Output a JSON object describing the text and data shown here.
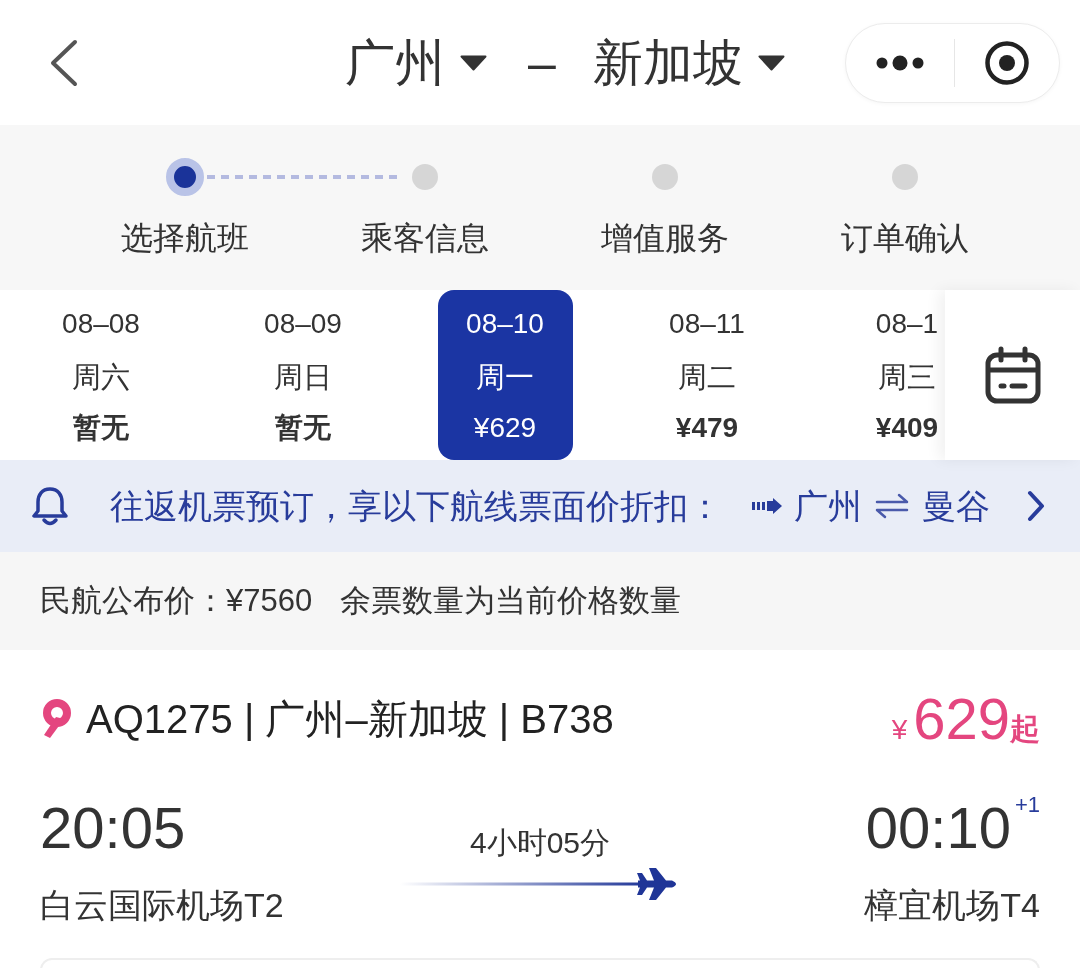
{
  "header": {
    "from_city": "广州",
    "separator": "–",
    "to_city": "新加坡"
  },
  "steps": [
    {
      "label": "选择航班",
      "selected": true
    },
    {
      "label": "乘客信息",
      "selected": false
    },
    {
      "label": "增值服务",
      "selected": false
    },
    {
      "label": "订单确认",
      "selected": false
    }
  ],
  "dates": [
    {
      "date": "08–08",
      "weekday": "周六",
      "price": "暂无",
      "selected": false
    },
    {
      "date": "08–09",
      "weekday": "周日",
      "price": "暂无",
      "selected": false
    },
    {
      "date": "08–10",
      "weekday": "周一",
      "price": "¥629",
      "selected": true
    },
    {
      "date": "08–11",
      "weekday": "周二",
      "price": "¥479",
      "selected": false
    },
    {
      "date": "08–1",
      "weekday": "周三",
      "price": "¥409",
      "selected": false
    }
  ],
  "promo_banner": {
    "text": "往返机票预订，享以下航线票面价折扣：",
    "from_city": "广州",
    "to_city": "曼谷"
  },
  "notice": {
    "official_price": "民航公布价：¥7560",
    "remark": "余票数量为当前价格数量"
  },
  "flight": {
    "title": "AQ1275 | 广州–新加坡 | B738",
    "price": {
      "currency": "¥",
      "amount": "629",
      "suffix": "起"
    },
    "departure": {
      "time": "20:05",
      "airport": "白云国际机场T2"
    },
    "duration": "4小时05分",
    "arrival": {
      "time": "00:10",
      "day_offset": "+1",
      "airport": "樟宜机场T4"
    }
  }
}
